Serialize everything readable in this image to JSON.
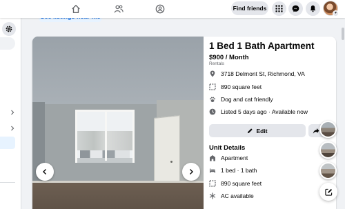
{
  "header": {
    "find_friends_label": "Find friends",
    "nav_icons": [
      "home-icon",
      "friends-icon",
      "groups-icon"
    ],
    "action_icons": [
      "menu-grid-icon",
      "messenger-icon",
      "notifications-bell-icon"
    ],
    "account_badge_icon": "chevron-down-icon"
  },
  "left_panel": {
    "settings_icon": "gear-icon",
    "chevron_icons": [
      "chevron-right-icon",
      "chevron-right-icon"
    ]
  },
  "banner": {
    "see_listings_label": "See listings near me"
  },
  "listing": {
    "title": "1 Bed 1 Bath Apartment",
    "price": "$900 / Month",
    "category": "Rentals",
    "info_rows": [
      {
        "icon": "location-pin-icon",
        "text": "3718 Delmont St, Richmond, VA"
      },
      {
        "icon": "square-footage-icon",
        "text": "890 square feet"
      },
      {
        "icon": "paw-icon",
        "text": "Dog and cat friendly"
      },
      {
        "icon": "clock-icon",
        "text": "Listed 5 days ago · Available now"
      }
    ],
    "edit_label": "Edit",
    "share_icon": "share-arrow-icon",
    "unit_details_heading": "Unit Details",
    "unit_rows": [
      {
        "icon": "apartment-icon",
        "text": "Apartment"
      },
      {
        "icon": "bed-icon",
        "text": "1 bed · 1 bath"
      },
      {
        "icon": "square-footage-icon",
        "text": "890 square feet"
      },
      {
        "icon": "snowflake-icon",
        "text": "AC available"
      }
    ]
  },
  "gallery": {
    "prev_icon": "chevron-left-icon",
    "next_icon": "chevron-right-icon"
  },
  "floating": {
    "compose_icon": "compose-icon"
  },
  "colors": {
    "accent": "#1877f2",
    "surface": "#ffffff",
    "background": "#f0f2f5",
    "button_gray": "#e4e6eb",
    "secondary_text": "#65676b"
  }
}
